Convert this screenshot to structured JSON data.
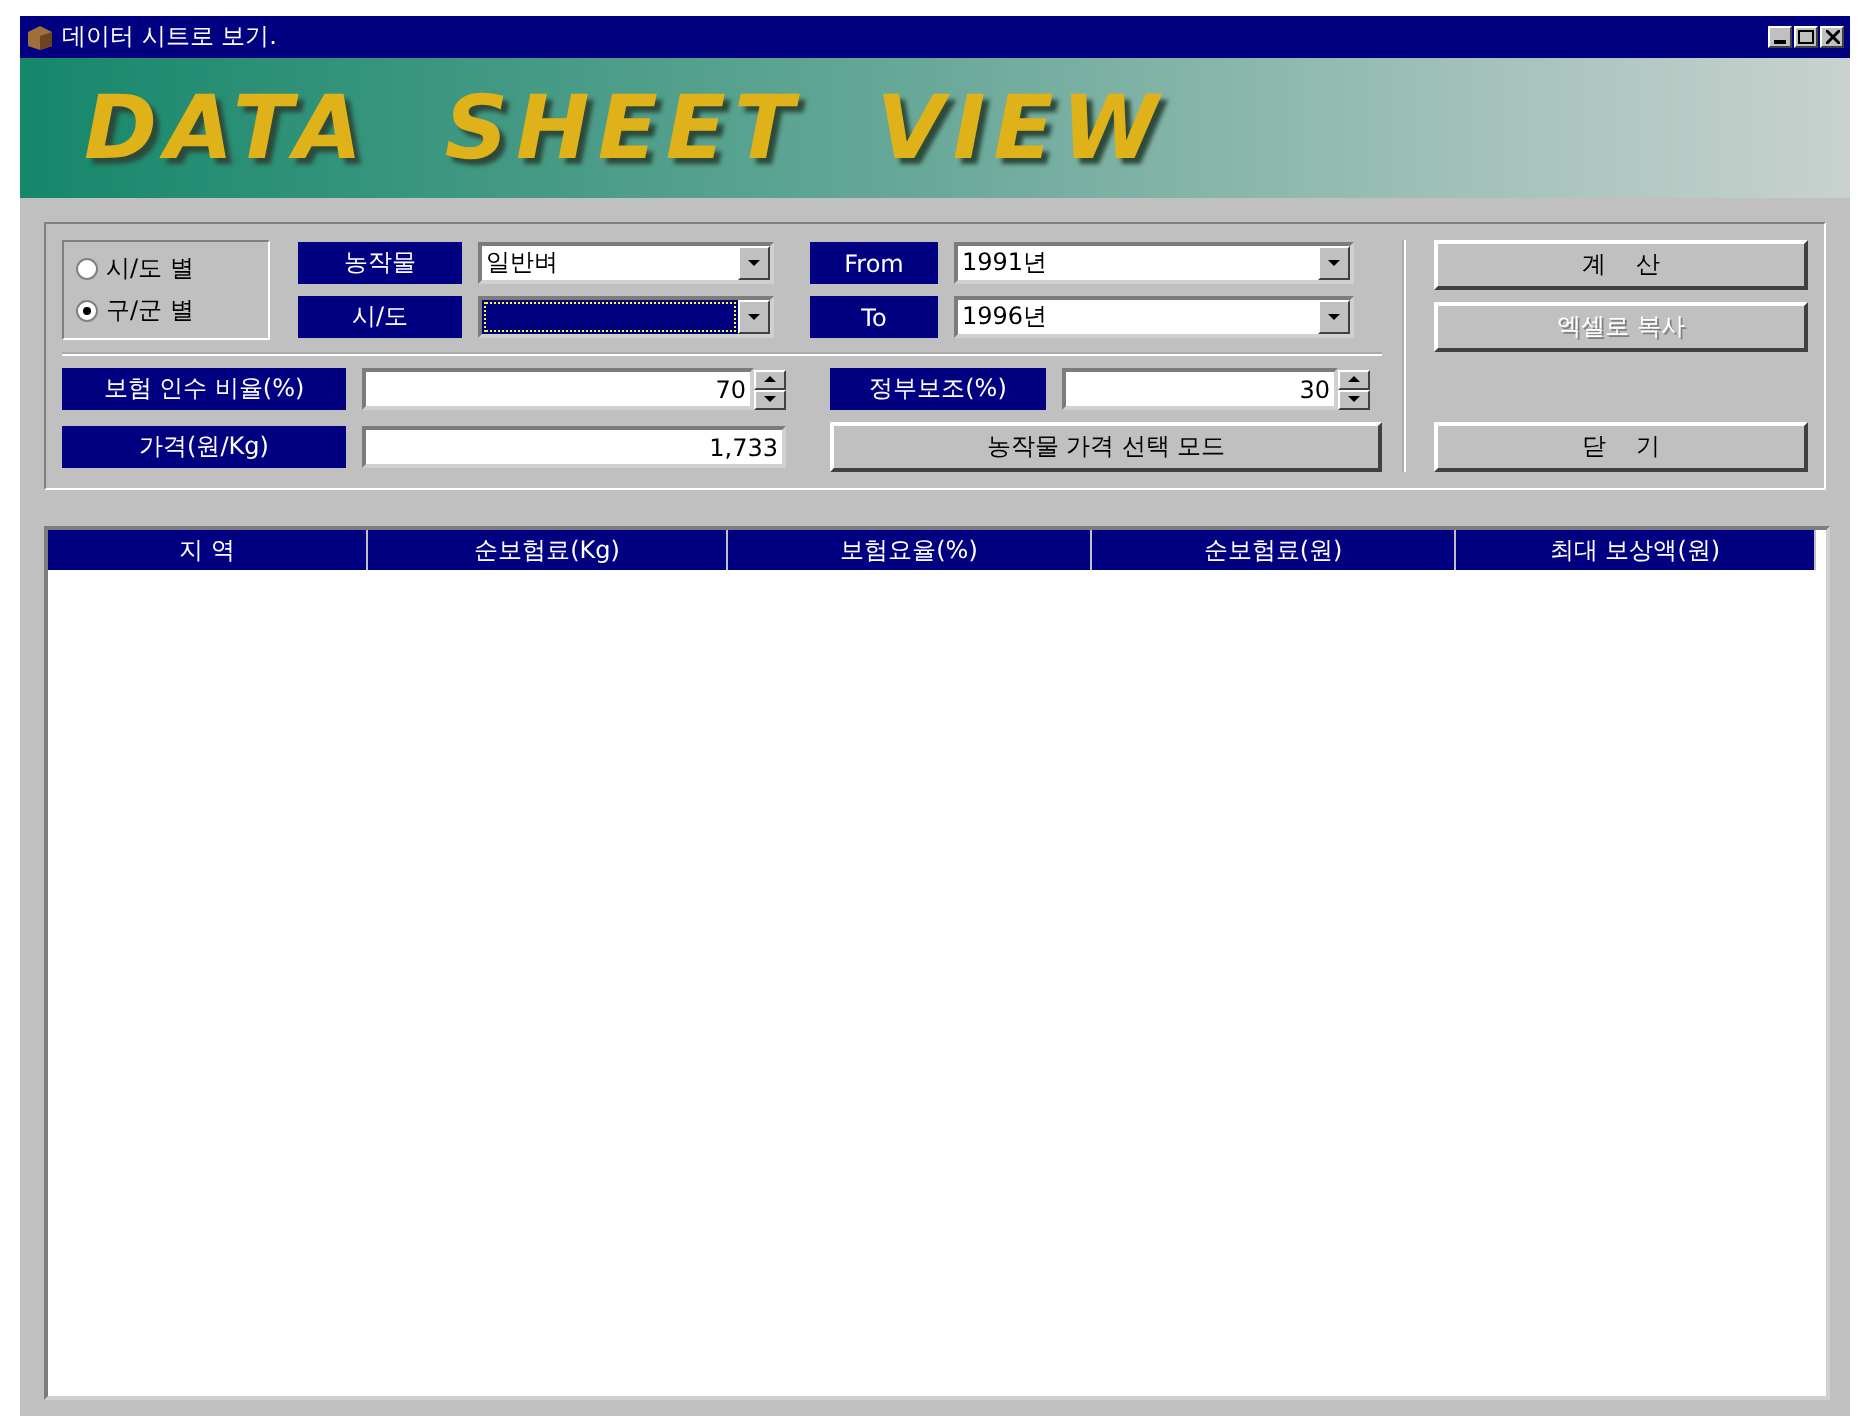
{
  "window": {
    "title": "데이터 시트로 보기."
  },
  "banner": {
    "title": "DATA SHEET VIEW"
  },
  "mode_radios": [
    {
      "label": "시/도 별",
      "selected": false
    },
    {
      "label": "구/군 별",
      "selected": true
    }
  ],
  "crop": {
    "label": "농작물",
    "value": "일반벼"
  },
  "region": {
    "label": "시/도",
    "highlighted": true
  },
  "from": {
    "label": "From",
    "value": "1991년"
  },
  "to": {
    "label": "To",
    "value": "1996년"
  },
  "coverage_ratio": {
    "label": "보험 인수 비율(%)",
    "value": "70"
  },
  "gov_subsidy": {
    "label": "정부보조(%)",
    "value": "30"
  },
  "price": {
    "label": "가격(원/Kg)",
    "value": "1,733"
  },
  "price_mode_button": {
    "label": "농작물 가격 선택 모드"
  },
  "buttons": [
    {
      "label": "계    산",
      "disabled": false
    },
    {
      "label": "엑셀로 복사",
      "disabled": true
    },
    {
      "label": "닫    기",
      "disabled": false
    }
  ],
  "table": {
    "columns": [
      "지 역",
      "순보험료(Kg)",
      "보험요율(%)",
      "순보험료(원)",
      "최대 보상액(원)"
    ]
  }
}
